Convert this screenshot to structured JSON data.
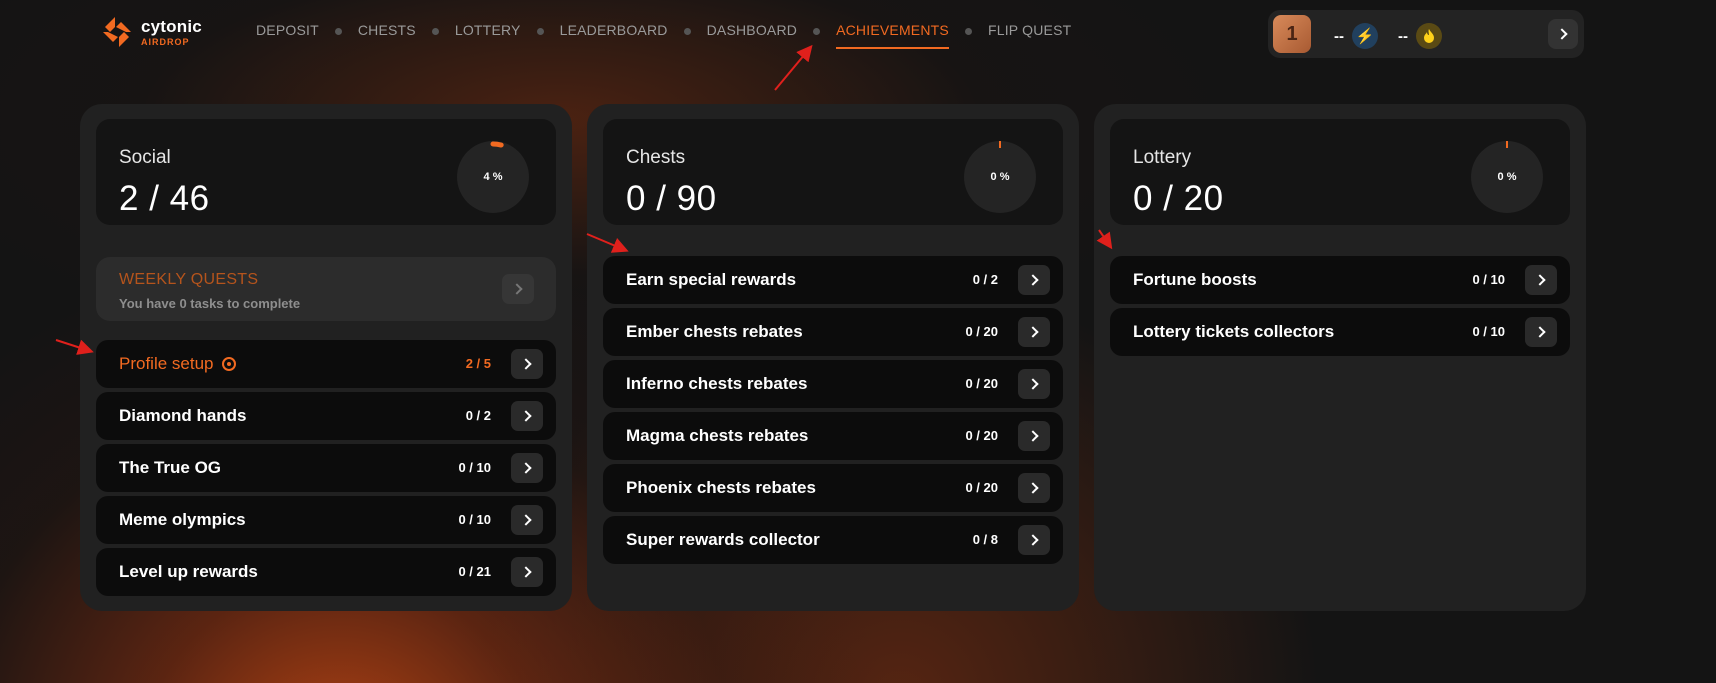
{
  "brand": {
    "name": "cytonic",
    "sub": "AIRDROP"
  },
  "nav": [
    {
      "label": "DEPOSIT"
    },
    {
      "label": "CHESTS"
    },
    {
      "label": "LOTTERY"
    },
    {
      "label": "LEADERBOARD"
    },
    {
      "label": "DASHBOARD"
    },
    {
      "label": "ACHIEVEMENTS",
      "active": true
    },
    {
      "label": "FLIP QUEST"
    }
  ],
  "user": {
    "avatar_letter": "1",
    "energy_value": "--",
    "fire_value": "--",
    "icons": {
      "energy": "lightning-icon",
      "fire": "flame-icon"
    }
  },
  "panels": {
    "social": {
      "title": "Social",
      "value": "2 / 46",
      "percent_label": "4 %",
      "progress": 0.04,
      "weekly": {
        "title": "WEEKLY QUESTS",
        "subtitle": "You have 0 tasks to complete"
      },
      "items": [
        {
          "label": "Profile setup",
          "count": "2 / 5"
        },
        {
          "label": "Diamond hands",
          "count": "0 / 2"
        },
        {
          "label": "The True OG",
          "count": "0 / 10"
        },
        {
          "label": "Meme olympics",
          "count": "0 / 10"
        },
        {
          "label": "Level up rewards",
          "count": "0 / 21"
        }
      ]
    },
    "chests": {
      "title": "Chests",
      "value": "0 / 90",
      "percent_label": "0 %",
      "progress": 0,
      "items": [
        {
          "label": "Earn special rewards",
          "count": "0 / 2"
        },
        {
          "label": "Ember chests rebates",
          "count": "0 / 20"
        },
        {
          "label": "Inferno chests rebates",
          "count": "0 / 20"
        },
        {
          "label": "Magma chests rebates",
          "count": "0 / 20"
        },
        {
          "label": "Phoenix chests rebates",
          "count": "0 / 20"
        },
        {
          "label": "Super rewards collector",
          "count": "0 / 8"
        }
      ]
    },
    "lottery": {
      "title": "Lottery",
      "value": "0 / 20",
      "percent_label": "0 %",
      "progress": 0,
      "items": [
        {
          "label": "Fortune boosts",
          "count": "0 / 10"
        },
        {
          "label": "Lottery tickets collectors",
          "count": "0 / 10"
        }
      ]
    }
  },
  "colors": {
    "accent": "#f26a21",
    "panel": "#212121",
    "row": "#0c0c0c",
    "annotation": "#e0201c"
  }
}
